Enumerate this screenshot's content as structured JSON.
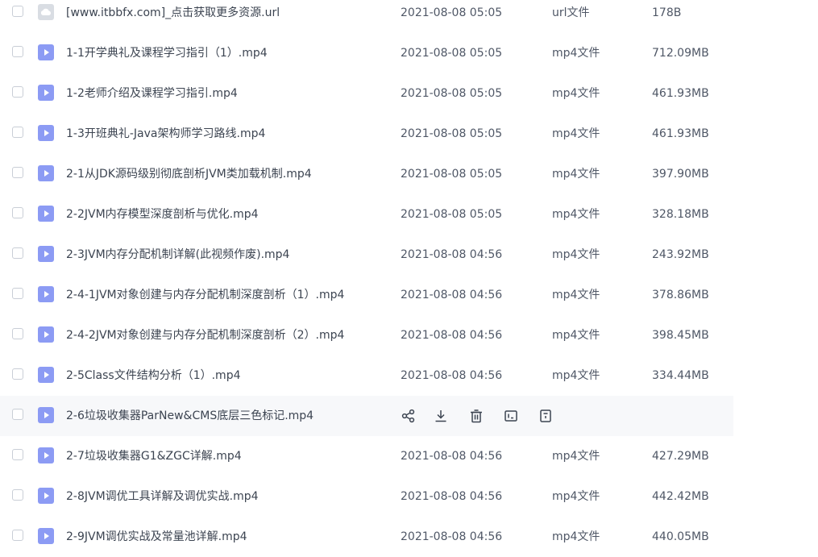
{
  "files": [
    {
      "name": "[www.itbbfx.com]_点击获取更多资源.url",
      "date": "2021-08-08 05:05",
      "type": "url文件",
      "size": "178B",
      "icon": "link-file-icon"
    },
    {
      "name": "1-1开学典礼及课程学习指引（1）.mp4",
      "date": "2021-08-08 05:05",
      "type": "mp4文件",
      "size": "712.09MB",
      "icon": "video-file-icon"
    },
    {
      "name": "1-2老师介绍及课程学习指引.mp4",
      "date": "2021-08-08 05:05",
      "type": "mp4文件",
      "size": "461.93MB",
      "icon": "video-file-icon"
    },
    {
      "name": "1-3开班典礼-Java架构师学习路线.mp4",
      "date": "2021-08-08 05:05",
      "type": "mp4文件",
      "size": "461.93MB",
      "icon": "video-file-icon"
    },
    {
      "name": "2-1从JDK源码级别彻底剖析JVM类加载机制.mp4",
      "date": "2021-08-08 05:05",
      "type": "mp4文件",
      "size": "397.90MB",
      "icon": "video-file-icon"
    },
    {
      "name": "2-2JVM内存模型深度剖析与优化.mp4",
      "date": "2021-08-08 05:05",
      "type": "mp4文件",
      "size": "328.18MB",
      "icon": "video-file-icon"
    },
    {
      "name": "2-3JVM内存分配机制详解(此视频作废).mp4",
      "date": "2021-08-08 04:56",
      "type": "mp4文件",
      "size": "243.92MB",
      "icon": "video-file-icon"
    },
    {
      "name": "2-4-1JVM对象创建与内存分配机制深度剖析（1）.mp4",
      "date": "2021-08-08 04:56",
      "type": "mp4文件",
      "size": "378.86MB",
      "icon": "video-file-icon"
    },
    {
      "name": "2-4-2JVM对象创建与内存分配机制深度剖析（2）.mp4",
      "date": "2021-08-08 04:56",
      "type": "mp4文件",
      "size": "398.45MB",
      "icon": "video-file-icon"
    },
    {
      "name": "2-5Class文件结构分析（1）.mp4",
      "date": "2021-08-08 04:56",
      "type": "mp4文件",
      "size": "334.44MB",
      "icon": "video-file-icon"
    },
    {
      "name": "2-6垃圾收集器ParNew&CMS底层三色标记.mp4",
      "hovered": true,
      "icon": "video-file-icon"
    },
    {
      "name": "2-7垃圾收集器G1&ZGC详解.mp4",
      "date": "2021-08-08 04:56",
      "type": "mp4文件",
      "size": "427.29MB",
      "icon": "video-file-icon"
    },
    {
      "name": "2-8JVM调优工具详解及调优实战.mp4",
      "date": "2021-08-08 04:56",
      "type": "mp4文件",
      "size": "442.42MB",
      "icon": "video-file-icon"
    },
    {
      "name": "2-9JVM调优实战及常量池详解.mp4",
      "date": "2021-08-08 04:56",
      "type": "mp4文件",
      "size": "440.05MB",
      "icon": "video-file-icon"
    }
  ],
  "row_actions": [
    "share-icon",
    "download-icon",
    "delete-icon",
    "rename-icon",
    "more-icon"
  ]
}
